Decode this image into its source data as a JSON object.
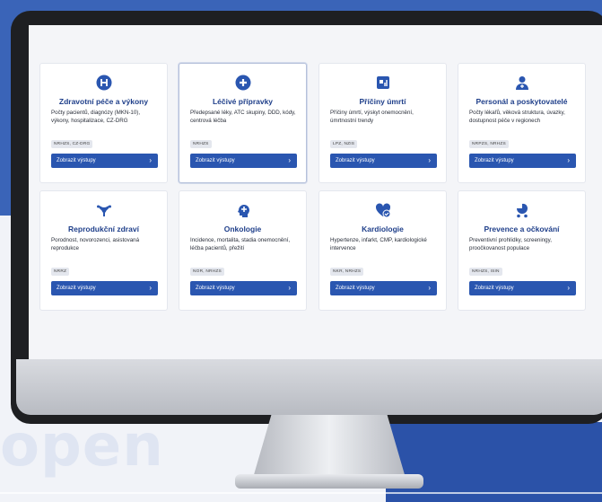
{
  "brand": "open",
  "cards": [
    {
      "title": "Zdravotní péče a výkony",
      "desc": "Počty pacientů, diagnózy (MKN-10), výkony, hospitalizace, CZ-DRG",
      "tag": "NRHZS, CZ-DRG",
      "button": "Zobrazit výstupy",
      "icon": "hospital-h-icon"
    },
    {
      "title": "Léčivé přípravky",
      "desc": "Předepsané léky, ATC skupiny, DDD, kódy, centrová léčba",
      "tag": "NRHZS",
      "button": "Zobrazit výstupy",
      "icon": "medical-cross-icon"
    },
    {
      "title": "Příčiny úmrtí",
      "desc": "Příčiny úmrtí, výskyt onemocnění, úmrtnostní trendy",
      "tag": "LPZ, NZIS",
      "button": "Zobrazit výstupy",
      "icon": "chart-document-icon"
    },
    {
      "title": "Personál a poskytovatelé",
      "desc": "Počty lékařů, věková struktura, úvazky, dostupnost péče v regionech",
      "tag": "NRPZS, NRHZS",
      "button": "Zobrazit výstupy",
      "icon": "doctor-icon"
    },
    {
      "title": "Reprodukční zdraví",
      "desc": "Porodnost, novorozenci, asistovaná reprodukce",
      "tag": "NRRZ",
      "button": "Zobrazit výstupy",
      "icon": "uterus-icon"
    },
    {
      "title": "Onkologie",
      "desc": "Incidence, mortalita, stadia onemocnění, léčba pacientů, přežití",
      "tag": "NOR, NRHZS",
      "button": "Zobrazit výstupy",
      "icon": "head-cross-icon"
    },
    {
      "title": "Kardiologie",
      "desc": "Hypertenze, infarkt, CMP, kardiologické intervence",
      "tag": "NKR, NRHZS",
      "button": "Zobrazit výstupy",
      "icon": "heart-check-icon"
    },
    {
      "title": "Prevence a očkování",
      "desc": "Preventivní prohlídky, screeningy, proočkovanost populace",
      "tag": "NRHZS, ISIN",
      "button": "Zobrazit výstupy",
      "icon": "baby-carriage-icon"
    }
  ],
  "colors": {
    "accent": "#2a56b0",
    "title": "#1f3f8a",
    "backdrop": "#3a64b8"
  }
}
